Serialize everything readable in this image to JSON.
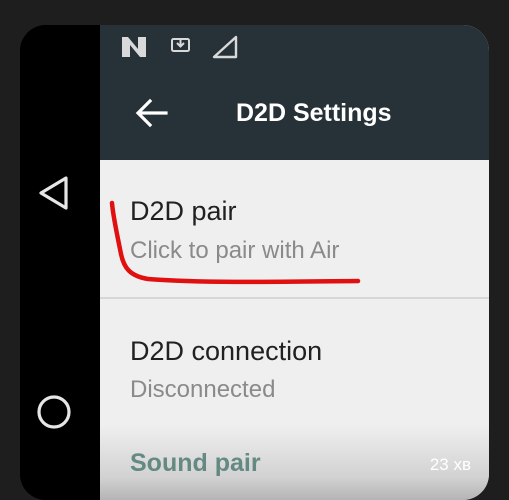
{
  "status_bar": {
    "icons": [
      "n-notification-icon",
      "download-icon",
      "signal-icon"
    ]
  },
  "app_bar": {
    "title": "D2D Settings",
    "back_icon": "back-arrow-icon"
  },
  "navigation_bar": {
    "icons": [
      "nav-back-icon",
      "nav-home-icon"
    ]
  },
  "preferences": [
    {
      "title": "D2D pair",
      "summary": "Click to pair with Air"
    },
    {
      "title": "D2D connection",
      "summary": "Disconnected"
    },
    {
      "title": "Sound pair"
    }
  ],
  "overlay": {
    "timestamp": "23 хв"
  },
  "colors": {
    "toolbar": "#263238",
    "background": "#efefef",
    "annotation": "#e01010"
  }
}
